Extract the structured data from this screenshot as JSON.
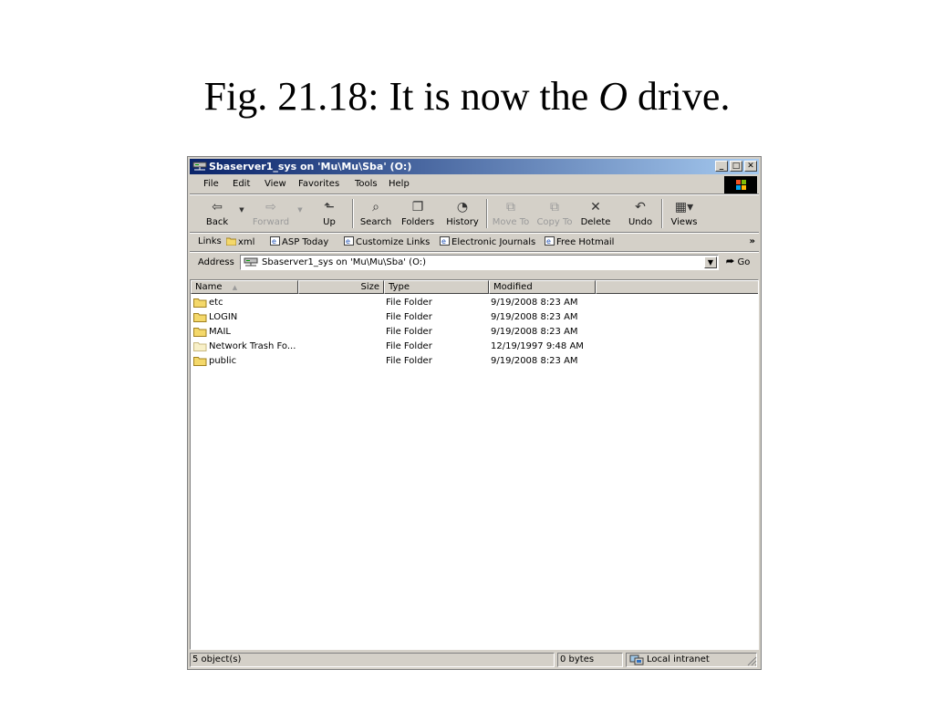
{
  "slide": {
    "title_prefix": "Fig. 21.18: It is now the ",
    "title_italic": "O",
    "title_suffix": " drive."
  },
  "window": {
    "title": "Sbaserver1_sys on 'Mu\\Mu\\Sba' (O:)",
    "controls": {
      "minimize": "_",
      "maximize": "□",
      "close": "✕"
    }
  },
  "menu": [
    "File",
    "Edit",
    "View",
    "Favorites",
    "Tools",
    "Help"
  ],
  "toolbar": {
    "back": "Back",
    "forward": "Forward",
    "up": "Up",
    "search": "Search",
    "folders": "Folders",
    "history": "History",
    "move_to": "Move To",
    "copy_to": "Copy To",
    "delete": "Delete",
    "undo": "Undo",
    "views": "Views"
  },
  "links": {
    "label": "Links",
    "items": [
      "xml",
      "ASP Today",
      "Customize Links",
      "Electronic Journals",
      "Free Hotmail"
    ],
    "more": "»"
  },
  "address": {
    "label": "Address",
    "value": "Sbaserver1_sys on 'Mu\\Mu\\Sba' (O:)",
    "go": "Go",
    "dropdown": "▼"
  },
  "columns": {
    "name": "Name",
    "size": "Size",
    "type": "Type",
    "modified": "Modified",
    "sort_indicator": "▲"
  },
  "files": [
    {
      "name": "etc",
      "size": "",
      "type": "File Folder",
      "modified": "9/19/2008 8:23 AM"
    },
    {
      "name": "LOGIN",
      "size": "",
      "type": "File Folder",
      "modified": "9/19/2008 8:23 AM"
    },
    {
      "name": "MAIL",
      "size": "",
      "type": "File Folder",
      "modified": "9/19/2008 8:23 AM"
    },
    {
      "name": "Network Trash Fo...",
      "size": "",
      "type": "File Folder",
      "modified": "12/19/1997 9:48 AM"
    },
    {
      "name": "public",
      "size": "",
      "type": "File Folder",
      "modified": "9/19/2008 8:23 AM"
    }
  ],
  "status": {
    "objects": "5 object(s)",
    "size": "0 bytes",
    "zone": "Local intranet"
  },
  "colors": {
    "folder": "#f4d86a",
    "title_start": "#0a246a",
    "title_end": "#a6caf0",
    "chrome": "#d4d0c8"
  }
}
